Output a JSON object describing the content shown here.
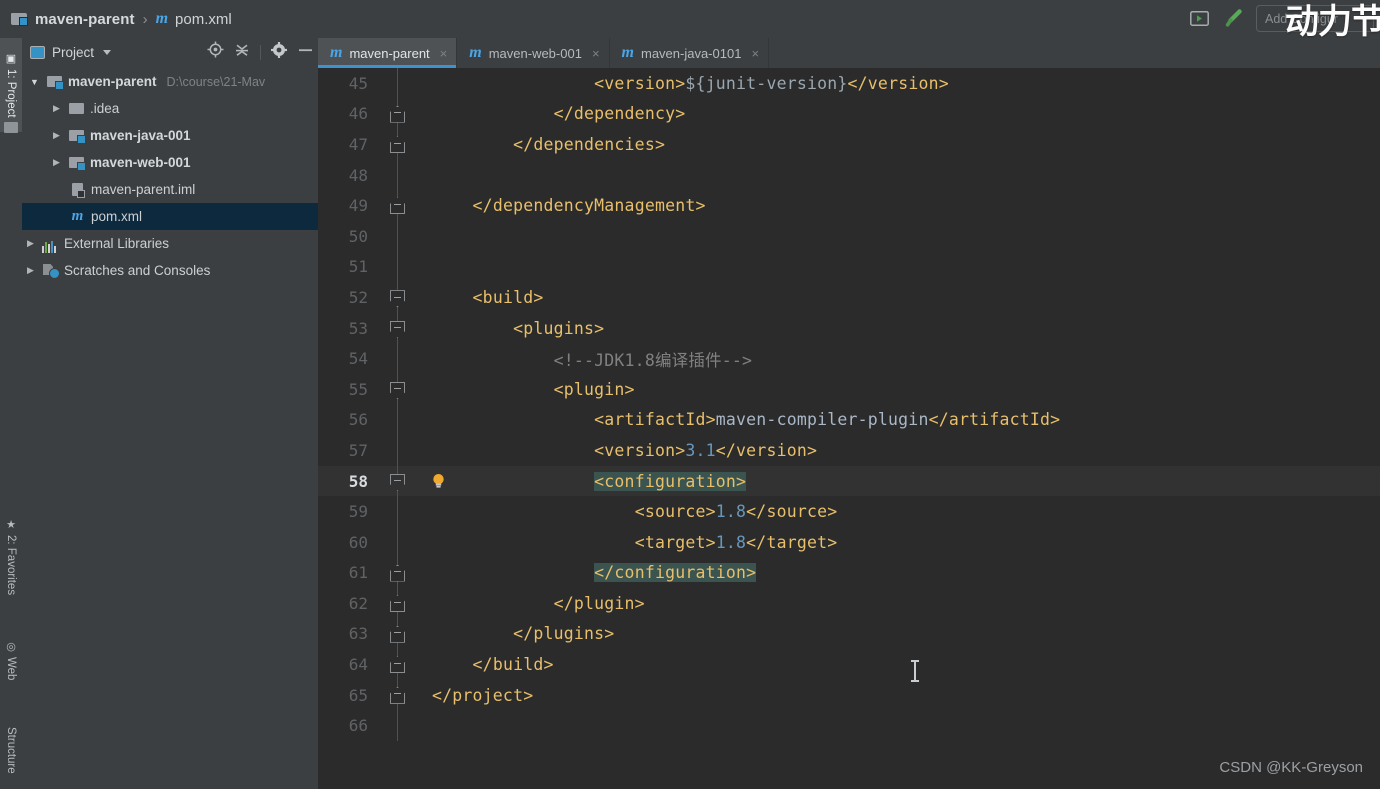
{
  "window": {
    "breadcrumb": {
      "project": "maven-parent",
      "separator": "›",
      "file": "pom.xml"
    },
    "toprght": {
      "run_icon": "run-window-icon",
      "build_icon": "build-hammer-icon",
      "add_configuration": "Add Configur"
    },
    "watermark_top": "动力节",
    "watermark_bottom": "CSDN @KK-Greyson"
  },
  "tool_strip": {
    "tabs": [
      {
        "label": "1: Project",
        "icon": "project-icon",
        "active": true
      },
      {
        "label": "2: Favorites",
        "icon": "star-icon",
        "active": false
      },
      {
        "label": "Web",
        "icon": "web-globe-icon",
        "active": false
      },
      {
        "label": "Structure",
        "icon": "structure-icon",
        "active": false
      }
    ]
  },
  "project_panel": {
    "title": "Project",
    "toolbar_icons": [
      "locate-target-icon",
      "collapse-all-icon",
      "gear-icon",
      "minimize-icon"
    ],
    "tree": [
      {
        "twist": "▼",
        "icon": "module-icon",
        "label": "maven-parent",
        "bold": true,
        "path": "D:\\course\\21-Mav",
        "indent": 0,
        "selected": false
      },
      {
        "twist": "▶",
        "icon": "folder-icon",
        "label": ".idea",
        "bold": false,
        "path": "",
        "indent": 1,
        "selected": false
      },
      {
        "twist": "▶",
        "icon": "module-icon",
        "label": "maven-java-001",
        "bold": true,
        "path": "",
        "indent": 1,
        "selected": false
      },
      {
        "twist": "▶",
        "icon": "module-icon",
        "label": "maven-web-001",
        "bold": true,
        "path": "",
        "indent": 1,
        "selected": false
      },
      {
        "twist": "",
        "icon": "iml-file-icon",
        "label": "maven-parent.iml",
        "bold": false,
        "path": "",
        "indent": 1,
        "selected": false
      },
      {
        "twist": "",
        "icon": "maven-pom-icon",
        "label": "pom.xml",
        "bold": false,
        "path": "",
        "indent": 1,
        "selected": true
      },
      {
        "twist": "▶",
        "icon": "library-icon",
        "label": "External Libraries",
        "bold": false,
        "path": "",
        "indent": 0,
        "selected": false
      },
      {
        "twist": "▶",
        "icon": "scratches-icon",
        "label": "Scratches and Consoles",
        "bold": false,
        "path": "",
        "indent": 0,
        "selected": false
      }
    ]
  },
  "editor": {
    "tabs": [
      {
        "label": "maven-parent",
        "icon": "maven-m-icon",
        "active": true,
        "close": "×"
      },
      {
        "label": "maven-web-001",
        "icon": "maven-m-icon",
        "active": false,
        "close": "×"
      },
      {
        "label": "maven-java-0101",
        "icon": "maven-m-icon",
        "active": false,
        "close": "×"
      }
    ],
    "caret_line": 58,
    "lines": [
      {
        "n": 45,
        "fold": "",
        "bulb": false,
        "html": "                <span class='tag'>&lt;version&gt;</span><span class='prop'>${junit-version}</span><span class='tag'>&lt;/version&gt;</span>"
      },
      {
        "n": 46,
        "fold": "up",
        "bulb": false,
        "html": "            <span class='tag'>&lt;/dependency&gt;</span>"
      },
      {
        "n": 47,
        "fold": "up",
        "bulb": false,
        "html": "        <span class='tag'>&lt;/dependencies&gt;</span>"
      },
      {
        "n": 48,
        "fold": "",
        "bulb": false,
        "html": ""
      },
      {
        "n": 49,
        "fold": "up",
        "bulb": false,
        "html": "    <span class='tag'>&lt;/dependencyManagement&gt;</span>"
      },
      {
        "n": 50,
        "fold": "",
        "bulb": false,
        "html": ""
      },
      {
        "n": 51,
        "fold": "",
        "bulb": false,
        "html": ""
      },
      {
        "n": 52,
        "fold": "down",
        "bulb": false,
        "html": "    <span class='tag'>&lt;build&gt;</span>"
      },
      {
        "n": 53,
        "fold": "down",
        "bulb": false,
        "html": "        <span class='tag'>&lt;plugins&gt;</span>"
      },
      {
        "n": 54,
        "fold": "",
        "bulb": false,
        "html": "            <span class='cmt'>&lt;!--JDK1.8编译插件--&gt;</span>"
      },
      {
        "n": 55,
        "fold": "down",
        "bulb": false,
        "html": "            <span class='tag'>&lt;plugin&gt;</span>"
      },
      {
        "n": 56,
        "fold": "",
        "bulb": false,
        "html": "                <span class='tag'>&lt;artifactId&gt;</span><span class='val'>maven-compiler-plugin</span><span class='tag'>&lt;/artifactId&gt;</span>"
      },
      {
        "n": 57,
        "fold": "",
        "bulb": false,
        "html": "                <span class='tag'>&lt;version&gt;</span><span class='num'>3.1</span><span class='tag'>&lt;/version&gt;</span>"
      },
      {
        "n": 58,
        "fold": "down",
        "bulb": true,
        "html": "                <span class='tag hl'>&lt;configuration&gt;</span>"
      },
      {
        "n": 59,
        "fold": "",
        "bulb": false,
        "html": "                    <span class='tag'>&lt;source&gt;</span><span class='num'>1.8</span><span class='tag'>&lt;/source&gt;</span>"
      },
      {
        "n": 60,
        "fold": "",
        "bulb": false,
        "html": "                    <span class='tag'>&lt;target&gt;</span><span class='num'>1.8</span><span class='tag'>&lt;/target&gt;</span>"
      },
      {
        "n": 61,
        "fold": "up",
        "bulb": false,
        "html": "                <span class='tag hl'>&lt;/configuration&gt;</span>"
      },
      {
        "n": 62,
        "fold": "up",
        "bulb": false,
        "html": "            <span class='tag'>&lt;/plugin&gt;</span>"
      },
      {
        "n": 63,
        "fold": "up",
        "bulb": false,
        "html": "        <span class='tag'>&lt;/plugins&gt;</span>"
      },
      {
        "n": 64,
        "fold": "up",
        "bulb": false,
        "html": "    <span class='tag'>&lt;/build&gt;</span>"
      },
      {
        "n": 65,
        "fold": "up",
        "bulb": false,
        "html": "<span class='tag'>&lt;/project&gt;</span>"
      },
      {
        "n": 66,
        "fold": "",
        "bulb": false,
        "html": ""
      }
    ]
  },
  "colors": {
    "editor_bg": "#2b2b2b",
    "panel_bg": "#3c3f41",
    "caret_line_bg": "#323232",
    "tag": "#e8bf6a",
    "number": "#6897bb",
    "comment": "#808080",
    "selection": "#0d293e",
    "accent": "#3d92d0",
    "brace_match_hl": "#3b5450"
  }
}
